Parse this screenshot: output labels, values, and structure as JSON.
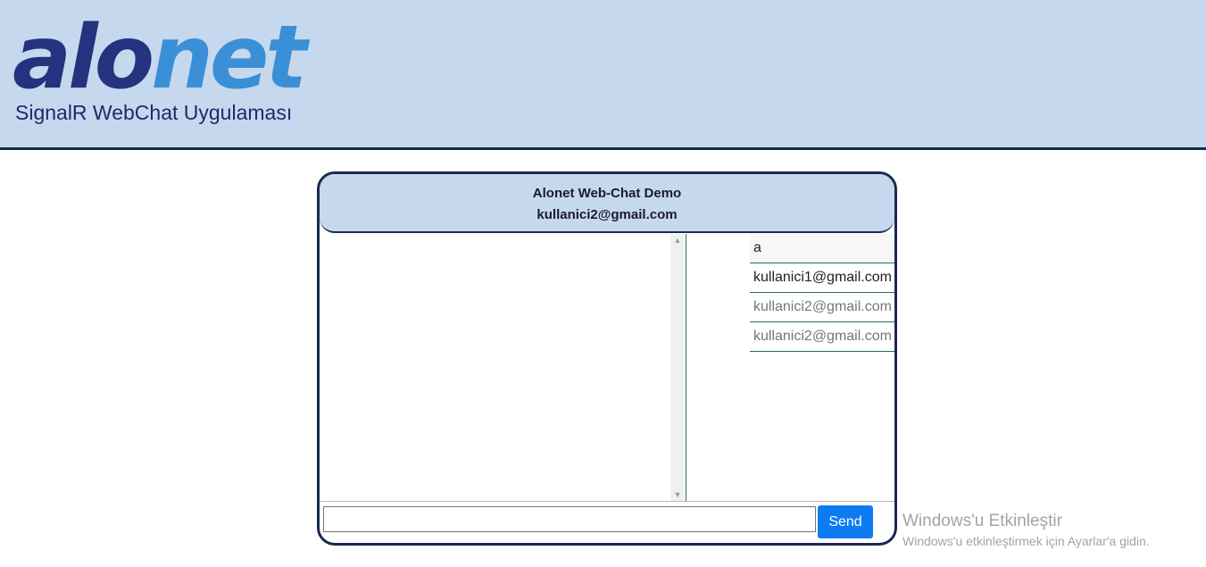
{
  "header": {
    "logo_text": "alonet",
    "subtitle": "SignalR WebChat Uygulaması"
  },
  "chat": {
    "title": "Alonet Web-Chat Demo",
    "current_user": "kullanici2@gmail.com",
    "messages": [],
    "users": [
      {
        "name": "a",
        "style": "default"
      },
      {
        "name": "kullanici1@gmail.com",
        "style": "default"
      },
      {
        "name": "kullanici2@gmail.com",
        "style": "muted"
      },
      {
        "name": "kullanici2@gmail.com",
        "style": "muted"
      }
    ],
    "input_value": "",
    "send_label": "Send"
  },
  "watermark": {
    "line1": "Windows'u Etkinleştir",
    "line2": "Windows'u etkinleştirmek için Ayarlar'a gidin."
  },
  "colors": {
    "header_bg": "#c5d8ed",
    "border_dark": "#1a2a4f",
    "logo_dark": "#23337f",
    "logo_light": "#3b8fd6",
    "send_button": "#0d7cf2"
  }
}
